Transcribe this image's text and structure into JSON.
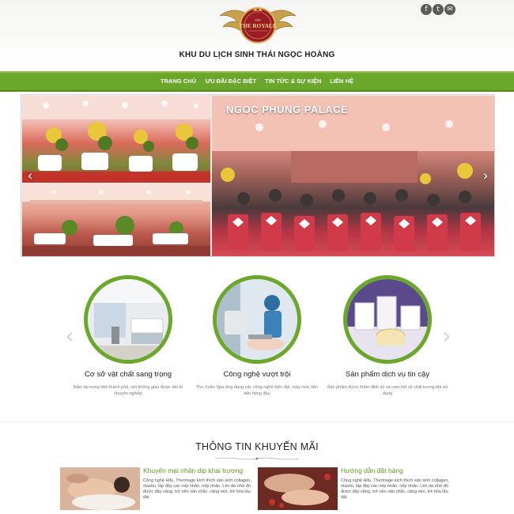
{
  "header": {
    "logo_text": "THE ROYALE",
    "logo_subtext": "THE",
    "site_title": "KHU DU LỊCH SINH THÁI NGỌC HOÀNG",
    "social": [
      {
        "icon": "facebook-icon",
        "glyph": "f"
      },
      {
        "icon": "twitter-icon",
        "glyph": "t"
      },
      {
        "icon": "email-icon",
        "glyph": "✉"
      }
    ]
  },
  "nav": {
    "items": [
      "TRANG CHỦ",
      "ƯU ĐÃI ĐẶC BIỆT",
      "TIN TỨC & SỰ KIỆN",
      "LIÊN HỆ"
    ]
  },
  "slider": {
    "caption": "NGOC PHUNG PALACE",
    "prev_glyph": "‹",
    "next_glyph": "›"
  },
  "features": {
    "prev_glyph": "‹",
    "next_glyph": "›",
    "items": [
      {
        "title": "Cơ sở vật chất sang trọng",
        "desc": "Nằm tại trung tâm thành phố, với không gian được bài trí chuyên nghiệp"
      },
      {
        "title": "Công nghệ vượt trội",
        "desc": "Thu Xuân Spa ứng dụng các công nghệ hiện đại, máy móc tiên tiến hàng đầu"
      },
      {
        "title": "Sản phẩm dịch vụ tin cậy",
        "desc": "Sản phẩm được thẩm định kỹ và cam kết về chất lượng khi sử dụng"
      }
    ]
  },
  "promo": {
    "title": "THÔNG TIN KHUYẾN MÃI",
    "cards": [
      {
        "heading": "Khuyến mại nhân dịp khai trương",
        "body": "Công nghệ Hifu, Thermage kích thích sản sinh collagen, elastin, lấp đầy các nếp nhăn, nếp nhăn. Lên da nhờ đó được đầy căng, trở nên săn chắc, căng mịn, trẻ hóa lâu dài."
      },
      {
        "heading": "Hướng dẫn đặt hàng",
        "body": "Công nghệ Hifu, Thermage kích thích sản sinh collagen, elastin, lấp đầy các nếp nhăn, nếp nhăn. Lên da nhờ đó được đầy căng, trở nên săn chắc, căng mịn, trẻ hóa lâu dài."
      }
    ]
  },
  "colors": {
    "accent_green": "#6aa72a",
    "logo_red": "#9b1b24",
    "logo_gold": "#c9a04a"
  }
}
